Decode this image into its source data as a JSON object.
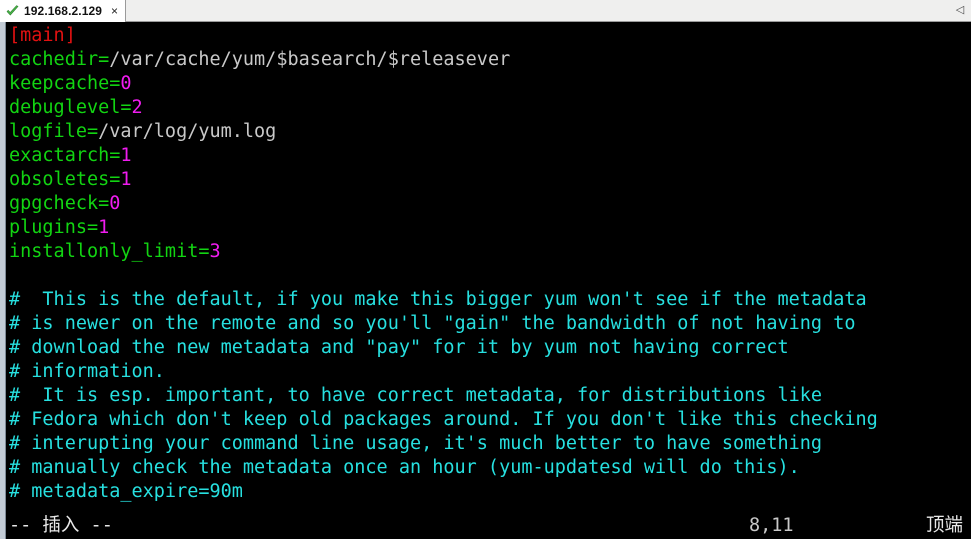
{
  "tabbar": {
    "tab": {
      "title": "192.168.2.129",
      "status_icon": "green-check-icon",
      "close_label": "×"
    },
    "scroll_left_label": "◁"
  },
  "terminal": {
    "lines": [
      {
        "id": "l1",
        "segments": [
          {
            "style": "section",
            "text": "[main]"
          }
        ]
      },
      {
        "id": "l2",
        "segments": [
          {
            "style": "key",
            "text": "cachedir="
          },
          {
            "style": "val",
            "text": "/var/cache/yum/$basearch/$releasever"
          }
        ]
      },
      {
        "id": "l3",
        "segments": [
          {
            "style": "key",
            "text": "keepcache="
          },
          {
            "style": "num",
            "text": "0"
          }
        ]
      },
      {
        "id": "l4",
        "segments": [
          {
            "style": "key",
            "text": "debuglevel="
          },
          {
            "style": "num",
            "text": "2"
          }
        ]
      },
      {
        "id": "l5",
        "segments": [
          {
            "style": "key",
            "text": "logfile="
          },
          {
            "style": "val",
            "text": "/var/log/yum.log"
          }
        ]
      },
      {
        "id": "l6",
        "segments": [
          {
            "style": "key",
            "text": "exactarch="
          },
          {
            "style": "num",
            "text": "1"
          }
        ]
      },
      {
        "id": "l7",
        "segments": [
          {
            "style": "key",
            "text": "obsoletes="
          },
          {
            "style": "num",
            "text": "1"
          }
        ]
      },
      {
        "id": "l8",
        "segments": [
          {
            "style": "key",
            "text": "gpgcheck="
          },
          {
            "style": "num",
            "text": "0"
          }
        ]
      },
      {
        "id": "l9",
        "segments": [
          {
            "style": "key",
            "text": "plugins="
          },
          {
            "style": "num",
            "text": "1"
          }
        ]
      },
      {
        "id": "l10",
        "segments": [
          {
            "style": "key",
            "text": "installonly_limit="
          },
          {
            "style": "num",
            "text": "3"
          }
        ]
      },
      {
        "id": "l11",
        "segments": [
          {
            "style": "val",
            "text": ""
          }
        ]
      },
      {
        "id": "l12",
        "segments": [
          {
            "style": "comment",
            "text": "#  This is the default, if you make this bigger yum won't see if the metadata"
          }
        ]
      },
      {
        "id": "l13",
        "segments": [
          {
            "style": "comment",
            "text": "# is newer on the remote and so you'll \"gain\" the bandwidth of not having to"
          }
        ]
      },
      {
        "id": "l14",
        "segments": [
          {
            "style": "comment",
            "text": "# download the new metadata and \"pay\" for it by yum not having correct"
          }
        ]
      },
      {
        "id": "l15",
        "segments": [
          {
            "style": "comment",
            "text": "# information."
          }
        ]
      },
      {
        "id": "l16",
        "segments": [
          {
            "style": "comment",
            "text": "#  It is esp. important, to have correct metadata, for distributions like"
          }
        ]
      },
      {
        "id": "l17",
        "segments": [
          {
            "style": "comment",
            "text": "# Fedora which don't keep old packages around. If you don't like this checking"
          }
        ]
      },
      {
        "id": "l18",
        "segments": [
          {
            "style": "comment",
            "text": "# interupting your command line usage, it's much better to have something"
          }
        ]
      },
      {
        "id": "l19",
        "segments": [
          {
            "style": "comment",
            "text": "# manually check the metadata once an hour (yum-updatesd will do this)."
          }
        ]
      },
      {
        "id": "l20",
        "segments": [
          {
            "style": "comment",
            "text": "# metadata_expire=90m"
          }
        ]
      }
    ],
    "statusline": {
      "mode": "-- 插入 --",
      "cursor_position": "8,11",
      "scroll_state": "顶端"
    }
  },
  "colors": {
    "background": "#000000",
    "section": "#e11111",
    "key": "#12d412",
    "value": "#c9c9c9",
    "number": "#f01cf0",
    "comment": "#27e0e0",
    "status_text": "#e8e8e8",
    "tabbar_bg": "#efefee",
    "tab_bg": "#ffffff"
  }
}
